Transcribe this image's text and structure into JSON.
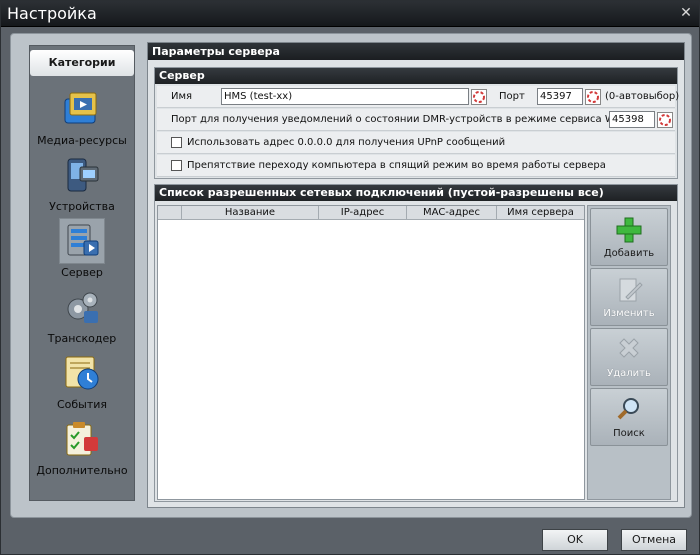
{
  "window": {
    "title": "Настройка",
    "close_glyph": "✕"
  },
  "sidebar": {
    "header": "Категории",
    "items": [
      {
        "label": "Медиа-ресурсы",
        "icon": "media-resources-icon",
        "active": false
      },
      {
        "label": "Устройства",
        "icon": "devices-icon",
        "active": false
      },
      {
        "label": "Сервер",
        "icon": "server-icon",
        "active": true
      },
      {
        "label": "Транскодер",
        "icon": "transcoder-icon",
        "active": false
      },
      {
        "label": "События",
        "icon": "events-icon",
        "active": false
      },
      {
        "label": "Дополнительно",
        "icon": "additional-icon",
        "active": false
      }
    ]
  },
  "main": {
    "header": "Параметры сервера",
    "server_group": {
      "title": "Сервер",
      "name_label": "Имя",
      "name_value": "HMS (test-xx)",
      "port_label": "Порт",
      "port_value": "45397",
      "port_hint": "(0-автовыбор)",
      "dmr_port_label": "Порт для получения уведомлений о состоянии DMR-устройств в режиме сервиса Windows",
      "dmr_port_value": "45398",
      "checkbox_upnp": "Использовать адрес 0.0.0.0 для получения UPnP сообщений",
      "checkbox_sleep": "Препятствие переходу компьютера в спящий режим во время работы сервера"
    },
    "connections_group": {
      "title": "Список разрешенных сетевых подключений (пустой-разрешены все)",
      "columns": [
        "",
        "Название",
        "IP-адрес",
        "MAC-адрес",
        "Имя сервера"
      ],
      "rows": [],
      "buttons": [
        {
          "label": "Добавить",
          "icon": "add-icon",
          "enabled": true
        },
        {
          "label": "Изменить",
          "icon": "edit-icon",
          "enabled": false
        },
        {
          "label": "Удалить",
          "icon": "delete-icon",
          "enabled": false
        },
        {
          "label": "Поиск",
          "icon": "search-icon",
          "enabled": true
        }
      ]
    }
  },
  "footer": {
    "ok_label": "OK",
    "cancel_label": "Отмена"
  }
}
